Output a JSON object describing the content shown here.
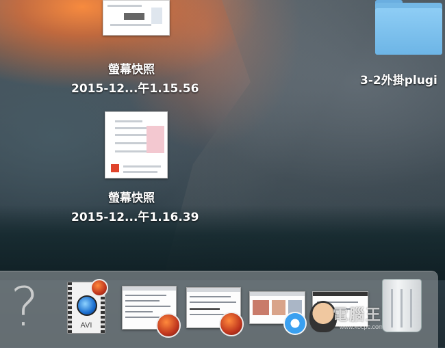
{
  "desktop": {
    "icons": [
      {
        "name_line1": "螢幕快照",
        "name_line2": "2015-12...午1.15.56"
      },
      {
        "name_line1": "螢幕快照",
        "name_line2": "2015-12...午1.16.39"
      },
      {
        "name_line1": "3-2外掛plugi"
      }
    ]
  },
  "dock": {
    "question_mark": "?",
    "avi_label": "AVI",
    "watermark": "電腦王阿達",
    "watermark_url": "www.kocpc.com.tw"
  },
  "colors": {
    "folder": "#74b8e6",
    "dock": "#7a8084"
  }
}
